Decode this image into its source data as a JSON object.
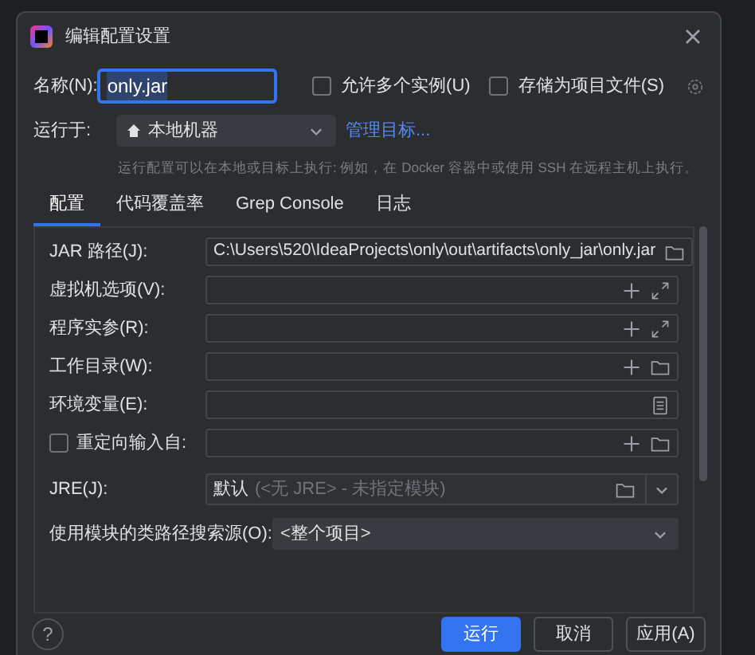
{
  "window": {
    "title": "编辑配置设置"
  },
  "name": {
    "label": "名称(N):",
    "value": "only.jar"
  },
  "options": [
    {
      "label": "允许多个实例(U)",
      "checked": false
    },
    {
      "label": "存储为项目文件(S)",
      "checked": false
    }
  ],
  "run_on": {
    "label": "运行于:",
    "value": "本地机器",
    "link": "管理目标..."
  },
  "hint": "运行配置可以在本地或目标上执行: 例如，在 Docker 容器中或使用 SSH 在远程主机上执行。",
  "tabs": [
    {
      "label": "配置",
      "selected": true
    },
    {
      "label": "代码覆盖率",
      "selected": false
    },
    {
      "label": "Grep Console",
      "selected": false
    },
    {
      "label": "日志",
      "selected": false
    }
  ],
  "fields": [
    {
      "label": "JAR 路径(J):",
      "value": "C:\\Users\\520\\IdeaProjects\\only\\out\\artifacts\\only_jar\\only.jar",
      "kind": "file"
    },
    {
      "label": "虚拟机选项(V):",
      "kind": "expandable"
    },
    {
      "label": "程序实参(R):",
      "kind": "expandable"
    },
    {
      "label": "工作目录(W):",
      "kind": "directory"
    },
    {
      "label": "环境变量(E):",
      "kind": "env"
    },
    {
      "label": "重定向输入自:",
      "checked": false,
      "kind": "directory"
    }
  ],
  "jre": {
    "label": "JRE(J):",
    "value": "默认",
    "hint": "(<无 JRE> - 未指定模块)"
  },
  "classpath": {
    "label": "使用模块的类路径搜索源(O):",
    "value": "<整个项目>"
  },
  "help": "?",
  "buttons": [
    {
      "label": "运行",
      "primary": true
    },
    {
      "label": "取消",
      "primary": false
    },
    {
      "label": "应用(A)",
      "primary": false
    }
  ]
}
